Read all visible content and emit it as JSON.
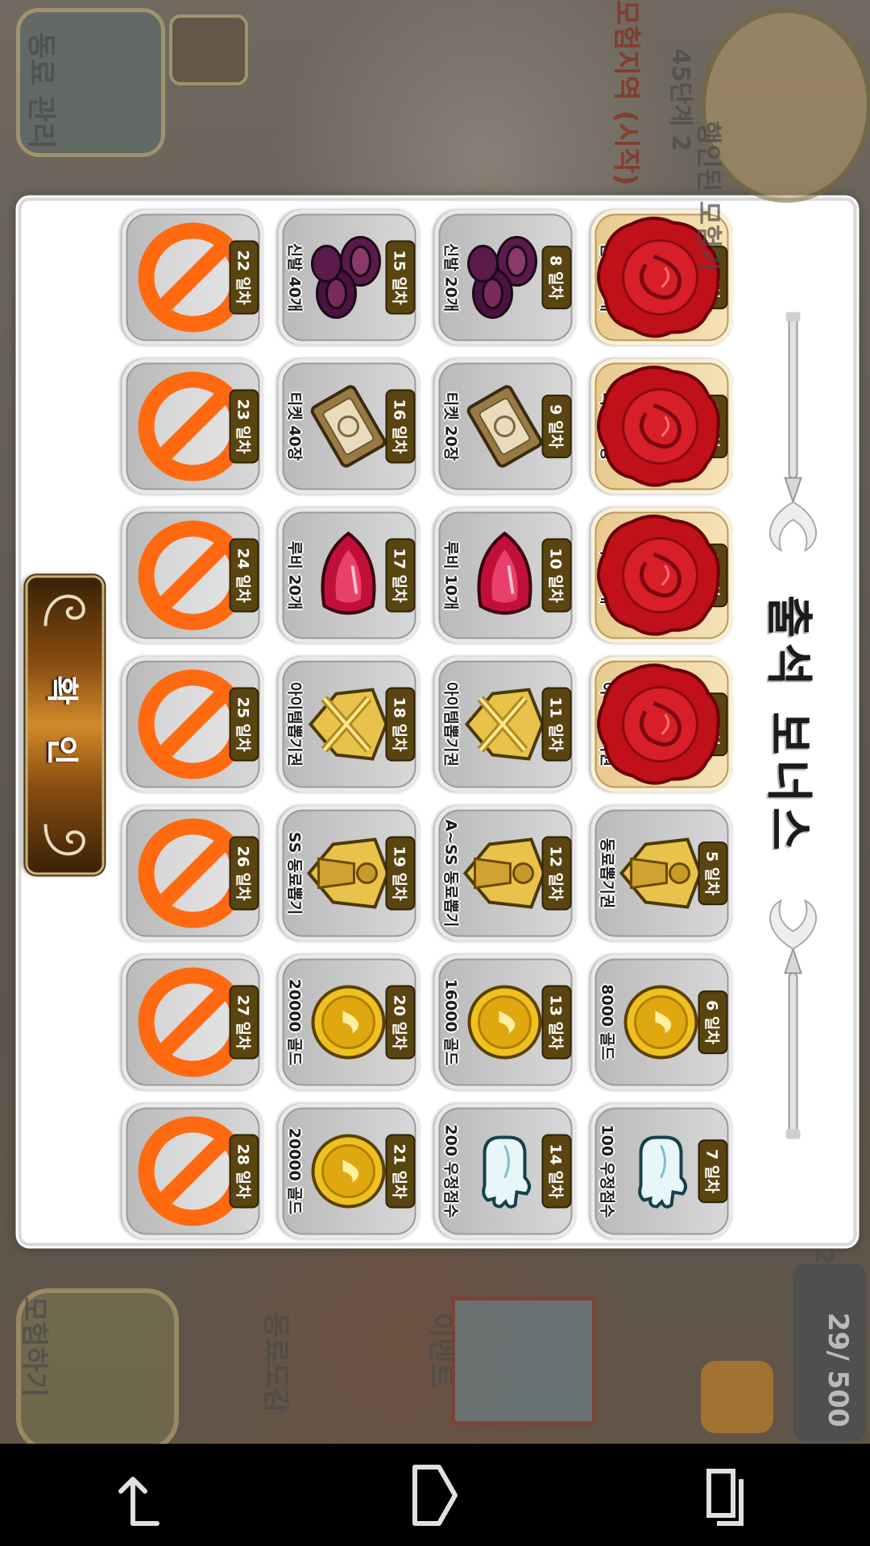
{
  "background": {
    "profile_title": "행인된 모험가",
    "profile_sub": "45단계 2",
    "hud_menu_label": "동료 관리",
    "stage_label": "모험지역 (시작)",
    "bottom_adventure": "모험하기",
    "bottom_book": "동료도감",
    "bottom_event": "이벤트",
    "stamina": "29/ 500",
    "stamina_prefix": "2"
  },
  "dialog": {
    "title": "출석 보너스",
    "confirm_label": "확 인"
  },
  "days": [
    {
      "day": "1 일차",
      "label": "신발 10개",
      "icon": "shoe-icon",
      "state": "claimed"
    },
    {
      "day": "2 일차",
      "label": "티켓 10장",
      "icon": "ticket-icon",
      "state": "claimed"
    },
    {
      "day": "3 일차",
      "label": "루비 5개",
      "icon": "ruby-icon",
      "state": "claimed"
    },
    {
      "day": "4 일차",
      "label": "아이템뽑기권",
      "icon": "item-voucher-icon",
      "state": "claimed"
    },
    {
      "day": "5 일차",
      "label": "동료뽑기권",
      "icon": "ally-voucher-icon",
      "state": "available"
    },
    {
      "day": "6 일차",
      "label": "8000 골드",
      "icon": "gold-coin-icon",
      "state": "available"
    },
    {
      "day": "7 일차",
      "label": "100 우정점수",
      "icon": "friendship-hand-icon",
      "state": "available"
    },
    {
      "day": "8 일차",
      "label": "신발 20개",
      "icon": "shoe-icon",
      "state": "available"
    },
    {
      "day": "9 일차",
      "label": "티켓 20장",
      "icon": "ticket-icon",
      "state": "available"
    },
    {
      "day": "10 일차",
      "label": "루비 10개",
      "icon": "ruby-icon",
      "state": "available"
    },
    {
      "day": "11 일차",
      "label": "아이템뽑기권",
      "icon": "item-voucher-icon",
      "state": "available"
    },
    {
      "day": "12 일차",
      "label": "A~SS 동료뽑기",
      "icon": "ally-voucher-icon",
      "state": "available"
    },
    {
      "day": "13 일차",
      "label": "16000 골드",
      "icon": "gold-coin-icon",
      "state": "available"
    },
    {
      "day": "14 일차",
      "label": "200 우정점수",
      "icon": "friendship-hand-icon",
      "state": "available"
    },
    {
      "day": "15 일차",
      "label": "신발 40개",
      "icon": "shoe-icon",
      "state": "available"
    },
    {
      "day": "16 일차",
      "label": "티켓 40장",
      "icon": "ticket-icon",
      "state": "available"
    },
    {
      "day": "17 일차",
      "label": "루비 20개",
      "icon": "ruby-icon",
      "state": "available"
    },
    {
      "day": "18 일차",
      "label": "아이템뽑기권",
      "icon": "item-voucher-icon",
      "state": "available"
    },
    {
      "day": "19 일차",
      "label": "SS 동료뽑기",
      "icon": "ally-voucher-icon",
      "state": "available"
    },
    {
      "day": "20 일차",
      "label": "20000 골드",
      "icon": "gold-coin-icon",
      "state": "available"
    },
    {
      "day": "21 일차",
      "label": "20000 골드",
      "icon": "gold-coin-icon",
      "state": "available"
    },
    {
      "day": "22 일차",
      "label": "",
      "icon": "blocked-icon",
      "state": "blocked"
    },
    {
      "day": "23 일차",
      "label": "",
      "icon": "blocked-icon",
      "state": "blocked"
    },
    {
      "day": "24 일차",
      "label": "",
      "icon": "blocked-icon",
      "state": "blocked"
    },
    {
      "day": "25 일차",
      "label": "",
      "icon": "blocked-icon",
      "state": "blocked"
    },
    {
      "day": "26 일차",
      "label": "",
      "icon": "blocked-icon",
      "state": "blocked"
    },
    {
      "day": "27 일차",
      "label": "",
      "icon": "blocked-icon",
      "state": "blocked"
    },
    {
      "day": "28 일차",
      "label": "",
      "icon": "blocked-icon",
      "state": "blocked"
    }
  ],
  "navbar": {
    "back": "back-icon",
    "home": "home-icon",
    "recents": "recent-apps-icon"
  }
}
